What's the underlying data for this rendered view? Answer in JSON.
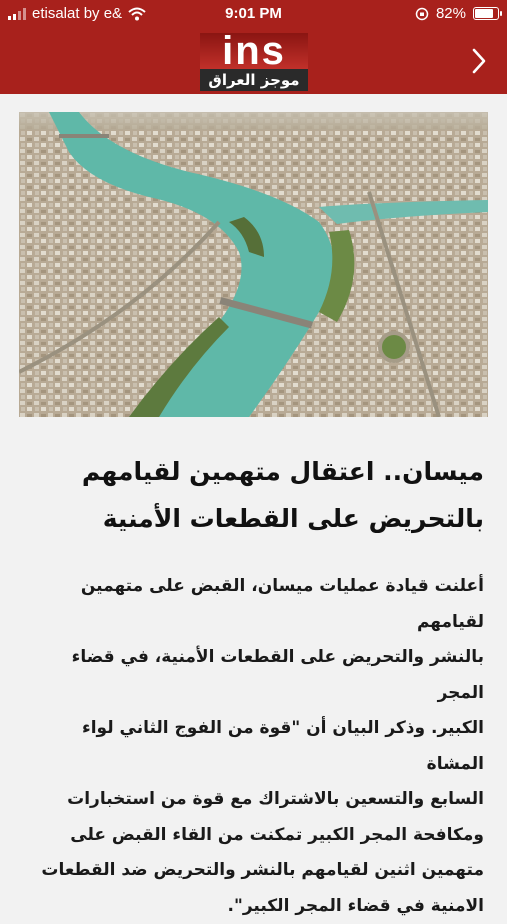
{
  "status": {
    "carrier": "etisalat by e&",
    "time": "9:01 PM",
    "battery": "82%",
    "battery_level": 0.82
  },
  "header": {
    "logo_main": "ins",
    "logo_sub": "موجز العراق",
    "back_icon": "chevron-right-icon"
  },
  "article": {
    "image_alt": "Aerial view of a river city",
    "title_line1": "ميسان.. اعتقال متهمين لقيامهم",
    "title_line2": "بالتحريض على القطعات الأمنية",
    "body": [
      "أعلنت قيادة عمليات ميسان،  القبض على متهمين لقيامهم",
      "بالنشر والتحريض على القطعات الأمنية، في قضاء المجر",
      "الكبير. وذكر البيان أن \"قوة من الفوج الثاني لواء المشاة",
      "السابع والتسعين بالاشتراك مع قوة من استخبارات",
      "ومكافحة المجر الكبير تمكنت من القاء القبض على",
      "متهمين اثنين لقيامهم بالنشر والتحريض ضد القطعات",
      "الامنية في قضاء المجر الكبير\"."
    ]
  },
  "colors": {
    "header_red": "#a8211c",
    "background": "#f2f2f2",
    "text": "#111111"
  }
}
